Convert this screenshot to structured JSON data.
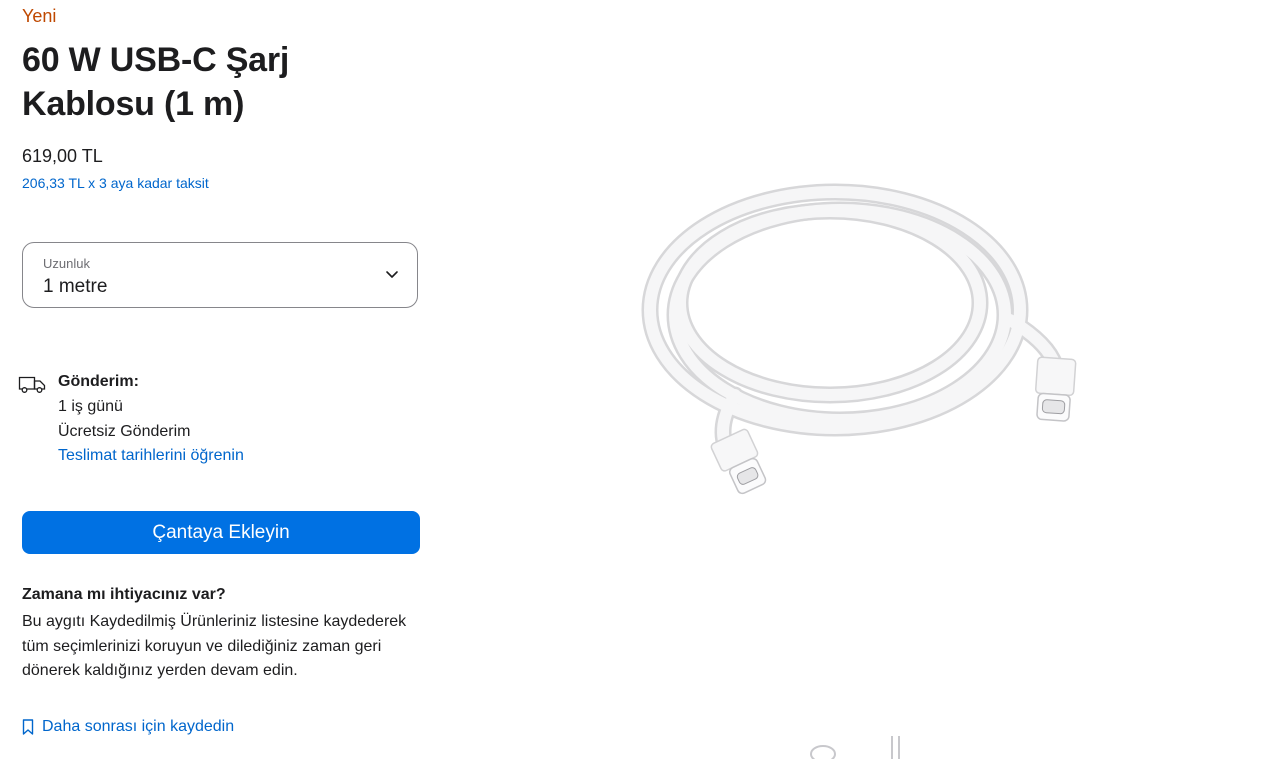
{
  "product": {
    "badge": "Yeni",
    "title_line1": "60 W USB-C Şarj",
    "title_line2": "Kablosu (1 m)",
    "price": "619,00 TL",
    "installment": "206,33 TL x 3 aya kadar taksit"
  },
  "length_select": {
    "label": "Uzunluk",
    "value": "1 metre"
  },
  "shipping": {
    "title": "Gönderim:",
    "line1": "1 iş günü",
    "line2": "Ücretsiz Gönderim",
    "link": "Teslimat tarihlerini öğrenin"
  },
  "add_to_bag": "Çantaya Ekleyin",
  "save": {
    "title": "Zamana mı ihtiyacınız var?",
    "description": "Bu aygıtı Kaydedilmiş Ürünleriniz listesine kaydederek tüm seçimlerinizi koruyun ve dilediğiniz zaman geri dönerek kaldığınız yerden devam edin.",
    "link": "Daha sonrası için kaydedin"
  },
  "colors": {
    "accent": "#0071e3",
    "link": "#0066cc",
    "new_badge": "#bf4800"
  },
  "icons": [
    "truck-icon",
    "chevron-down-icon",
    "bookmark-icon",
    "cable-thumbnail-icon",
    "earbuds-thumbnail-icon"
  ]
}
